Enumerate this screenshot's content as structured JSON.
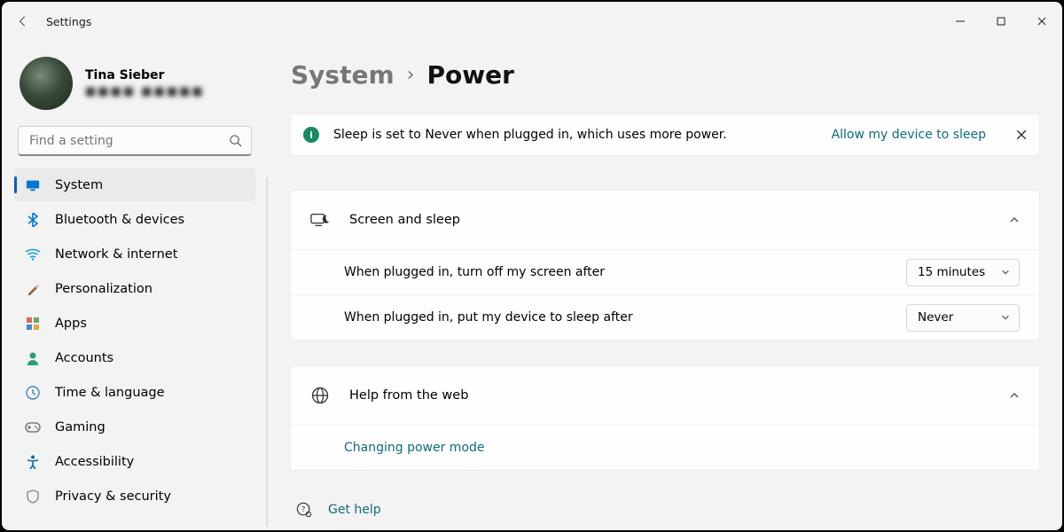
{
  "window": {
    "app_title": "Settings"
  },
  "user": {
    "name": "Tina Sieber",
    "sub_redacted": "■■■■ ■■■■■"
  },
  "search": {
    "placeholder": "Find a setting"
  },
  "sidebar": {
    "items": [
      {
        "label": "System",
        "icon": "display-icon",
        "color": "#0078d4",
        "selected": true
      },
      {
        "label": "Bluetooth & devices",
        "icon": "bluetooth-icon",
        "color": "#0078d4",
        "selected": false
      },
      {
        "label": "Network & internet",
        "icon": "wifi-icon",
        "color": "#18a0c8",
        "selected": false
      },
      {
        "label": "Personalization",
        "icon": "brush-icon",
        "color": "#8a6a4a",
        "selected": false
      },
      {
        "label": "Apps",
        "icon": "apps-icon",
        "color": "#5a5a8a",
        "selected": false
      },
      {
        "label": "Accounts",
        "icon": "person-icon",
        "color": "#2aa06a",
        "selected": false
      },
      {
        "label": "Time & language",
        "icon": "clock-icon",
        "color": "#4a8ac8",
        "selected": false
      },
      {
        "label": "Gaming",
        "icon": "gamepad-icon",
        "color": "#7a7a7a",
        "selected": false
      },
      {
        "label": "Accessibility",
        "icon": "accessibility-icon",
        "color": "#0d6aa8",
        "selected": false
      },
      {
        "label": "Privacy & security",
        "icon": "shield-icon",
        "color": "#8a8a8a",
        "selected": false
      }
    ]
  },
  "breadcrumb": {
    "parent": "System",
    "current": "Power"
  },
  "notice": {
    "text": "Sleep is set to Never when plugged in, which uses more power.",
    "link": "Allow my device to sleep"
  },
  "screen_sleep": {
    "header": "Screen and sleep",
    "rows": [
      {
        "label": "When plugged in, turn off my screen after",
        "value": "15 minutes"
      },
      {
        "label": "When plugged in, put my device to sleep after",
        "value": "Never"
      }
    ]
  },
  "help": {
    "header": "Help from the web",
    "links": [
      "Changing power mode"
    ]
  },
  "gethelp": {
    "label": "Get help"
  }
}
